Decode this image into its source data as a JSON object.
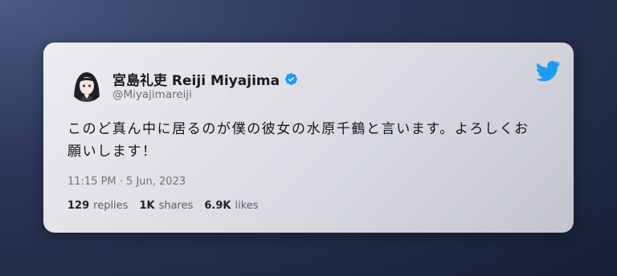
{
  "tweet": {
    "author": {
      "display_name": "宮島礼吏 Reiji Miyajima",
      "handle": "@Miyajimareiji",
      "verified": true
    },
    "text": "このど真ん中に居るのが僕の彼女の水原千鶴と言います。よろしくお願いします！",
    "timestamp": "11:15 PM · 5 Jun, 2023",
    "stats": [
      {
        "count": "129",
        "label": "replies"
      },
      {
        "count": "1K",
        "label": "shares"
      },
      {
        "count": "6.9K",
        "label": "likes"
      }
    ]
  },
  "icons": {
    "brand": "twitter-bird-icon",
    "verified": "verified-badge-icon"
  },
  "colors": {
    "twitter_blue": "#1d9bf0",
    "verified_blue": "#1d9bf0",
    "text_primary": "#15161b",
    "text_secondary": "#6b6e78"
  }
}
